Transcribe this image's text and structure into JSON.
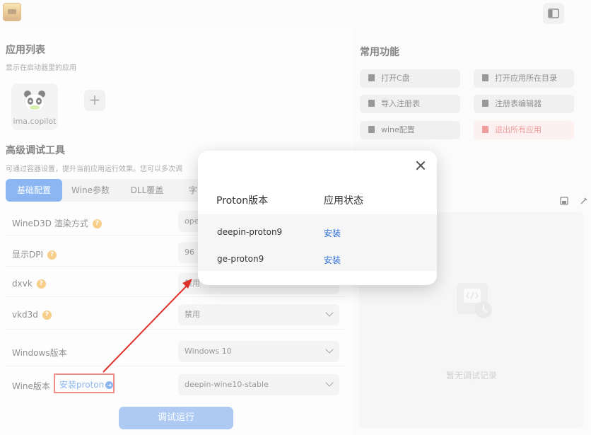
{
  "left_panel": {
    "app_list_title": "应用列表",
    "app_list_subtitle": "显示在启动器里的应用",
    "apps": [
      {
        "name": "ima.copilot"
      }
    ],
    "add_symbol": "+",
    "debug_tools_title": "高级调试工具",
    "debug_tools_subtitle": "可通过容器设置，提升当前应用运行效果。您可以多次调",
    "tabs": [
      "基础配置",
      "Wine参数",
      "DLL覆盖",
      "字"
    ],
    "active_tab": 0,
    "settings": [
      {
        "label": "WineD3D 渲染方式",
        "help": "?",
        "value": "ope"
      },
      {
        "label": "显示DPI",
        "help": "?",
        "value": "96"
      },
      {
        "label": "dxvk",
        "help": "?",
        "value": "禁用"
      },
      {
        "label": "vkd3d",
        "help": "?",
        "value": "禁用"
      },
      {
        "label": "Windows版本",
        "value": "Windows 10"
      },
      {
        "label": "Wine版本",
        "value": "deepin-wine10-stable"
      }
    ],
    "install_proton_link": "安装proton",
    "run_button": "调试运行"
  },
  "right_panel": {
    "common_functions_title": "常用功能",
    "buttons": [
      {
        "label": "打开C盘"
      },
      {
        "label": "打开应用所在目录"
      },
      {
        "label": "导入注册表"
      },
      {
        "label": "注册表编辑器"
      },
      {
        "label": "wine配置"
      },
      {
        "label": "退出所有应用"
      }
    ],
    "log_empty": "暂无调试记录"
  },
  "dialog": {
    "col_version": "Proton版本",
    "col_status": "应用状态",
    "rows": [
      {
        "version": "deepin-proton9",
        "action": "安装"
      },
      {
        "version": "ge-proton9",
        "action": "安装"
      }
    ]
  },
  "colors": {
    "accent": "#2d7be5",
    "danger": "#e24b4b",
    "highlight_red": "#e0302b",
    "help_orange": "#f0a72a"
  },
  "icons": [
    "app-logo-icon",
    "sidebar-toggle-icon",
    "help-icon",
    "chevron-down-icon",
    "arrow-right-circle-icon",
    "close-icon",
    "save-log-icon",
    "clear-log-icon",
    "empty-log-icon"
  ]
}
